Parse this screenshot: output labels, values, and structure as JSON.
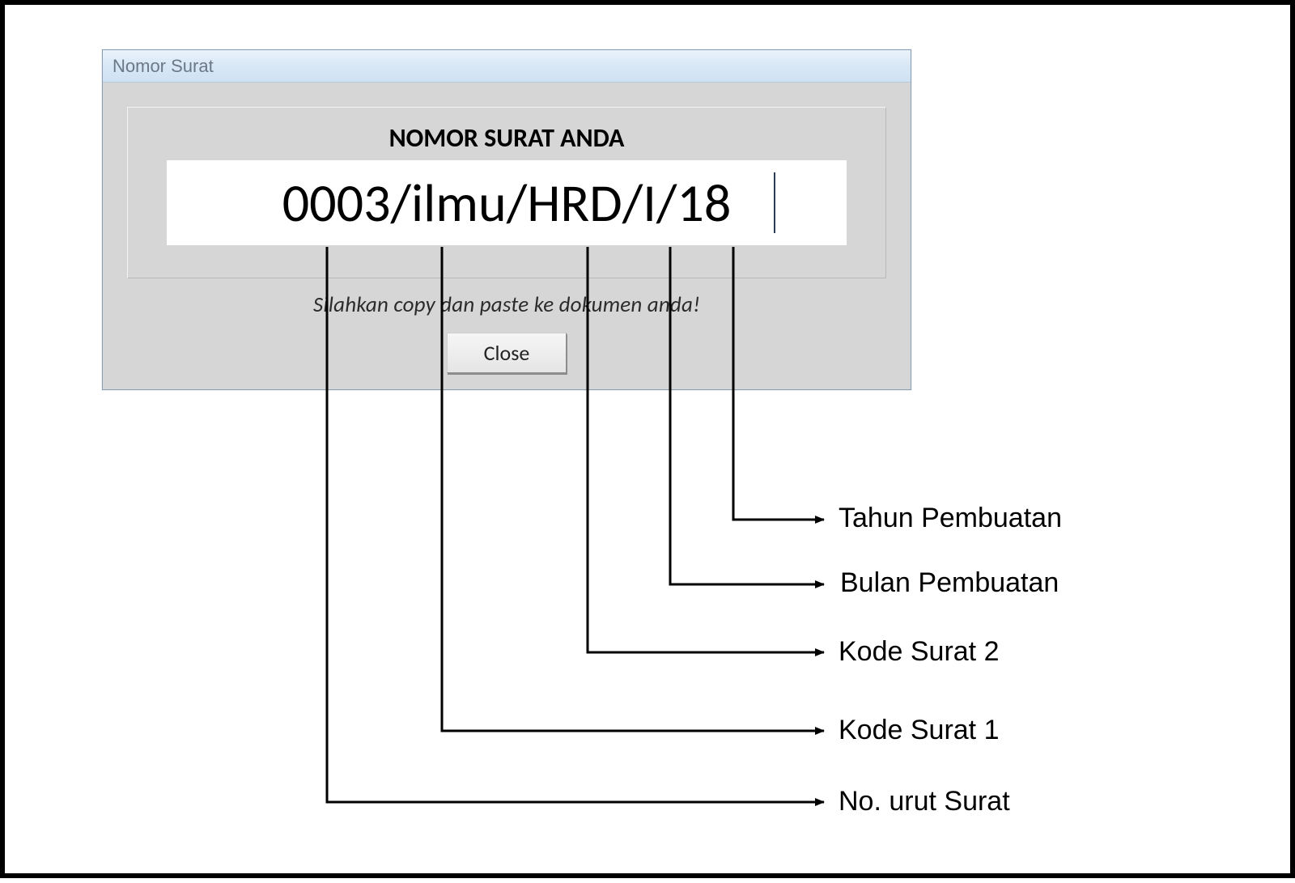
{
  "dialog": {
    "title": "Nomor Surat",
    "heading": "NOMOR SURAT ANDA",
    "letter_number": "0003/ilmu/HRD/I/18",
    "instruction": "Silahkan copy dan paste ke dokumen anda!",
    "close_label": "Close"
  },
  "annotations": {
    "tahun_pembuatan": "Tahun Pembuatan",
    "bulan_pembuatan": "Bulan Pembuatan",
    "kode_surat_2": "Kode Surat 2",
    "kode_surat_1": "Kode Surat 1",
    "no_urut": "No. urut Surat"
  },
  "letter_number_parts": {
    "no_urut": "0003",
    "kode_surat_1": "ilmu",
    "kode_surat_2": "HRD",
    "bulan": "I",
    "tahun": "18"
  },
  "colors": {
    "dialog_bg": "#d6d6d6",
    "titlebar_start": "#eaf3fb",
    "titlebar_end": "#cfe2f3",
    "title_text": "#6c7886",
    "line": "#000000"
  }
}
